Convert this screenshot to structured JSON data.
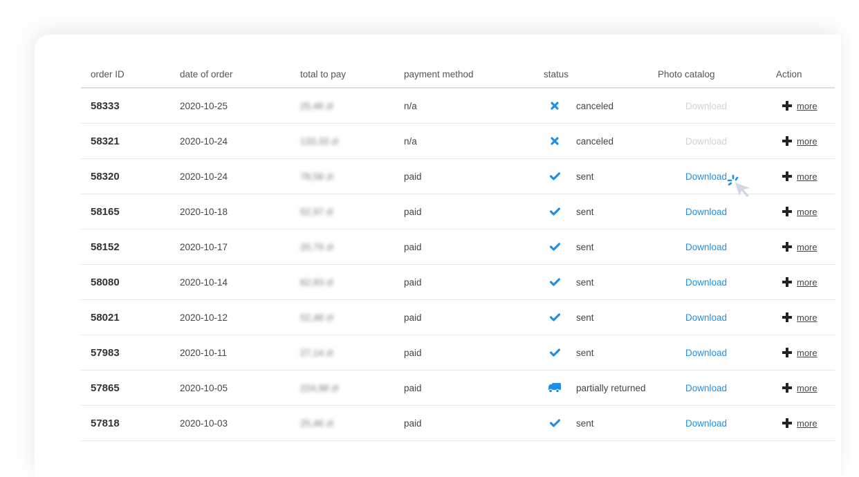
{
  "table": {
    "headers": {
      "order_id": "order ID",
      "date": "date of order",
      "total": "total to pay",
      "payment": "payment method",
      "status": "status",
      "photo": "Photo catalog",
      "action": "Action"
    },
    "rows": [
      {
        "id": "58333",
        "date": "2020-10-25",
        "total": "25,46 zł",
        "payment": "n/a",
        "status_icon": "x-icon",
        "status": "canceled",
        "download": "Download",
        "download_enabled": false,
        "more": "more"
      },
      {
        "id": "58321",
        "date": "2020-10-24",
        "total": "133,33 zł",
        "payment": "n/a",
        "status_icon": "x-icon",
        "status": "canceled",
        "download": "Download",
        "download_enabled": false,
        "more": "more"
      },
      {
        "id": "58320",
        "date": "2020-10-24",
        "total": "78,58 zł",
        "payment": "paid",
        "status_icon": "check-icon",
        "status": "sent",
        "download": "Download",
        "download_enabled": true,
        "more": "more"
      },
      {
        "id": "58165",
        "date": "2020-10-18",
        "total": "52,97 zł",
        "payment": "paid",
        "status_icon": "check-icon",
        "status": "sent",
        "download": "Download",
        "download_enabled": true,
        "more": "more"
      },
      {
        "id": "58152",
        "date": "2020-10-17",
        "total": "20,79 zł",
        "payment": "paid",
        "status_icon": "check-icon",
        "status": "sent",
        "download": "Download",
        "download_enabled": true,
        "more": "more"
      },
      {
        "id": "58080",
        "date": "2020-10-14",
        "total": "62,93 zł",
        "payment": "paid",
        "status_icon": "check-icon",
        "status": "sent",
        "download": "Download",
        "download_enabled": true,
        "more": "more"
      },
      {
        "id": "58021",
        "date": "2020-10-12",
        "total": "52,48 zł",
        "payment": "paid",
        "status_icon": "check-icon",
        "status": "sent",
        "download": "Download",
        "download_enabled": true,
        "more": "more"
      },
      {
        "id": "57983",
        "date": "2020-10-11",
        "total": "27,14 zł",
        "payment": "paid",
        "status_icon": "check-icon",
        "status": "sent",
        "download": "Download",
        "download_enabled": true,
        "more": "more"
      },
      {
        "id": "57865",
        "date": "2020-10-05",
        "total": "224,98 zł",
        "payment": "paid",
        "status_icon": "truck-icon",
        "status": "partially returned",
        "download": "Download",
        "download_enabled": true,
        "more": "more"
      },
      {
        "id": "57818",
        "date": "2020-10-03",
        "total": "25,46 zł",
        "payment": "paid",
        "status_icon": "check-icon",
        "status": "sent",
        "download": "Download",
        "download_enabled": true,
        "more": "more"
      }
    ]
  },
  "colors": {
    "accent": "#1e8fe6",
    "disabled_link": "#d2d2d2"
  },
  "cursor": {
    "icon": "click-cursor-icon",
    "hovering_row": 2
  }
}
